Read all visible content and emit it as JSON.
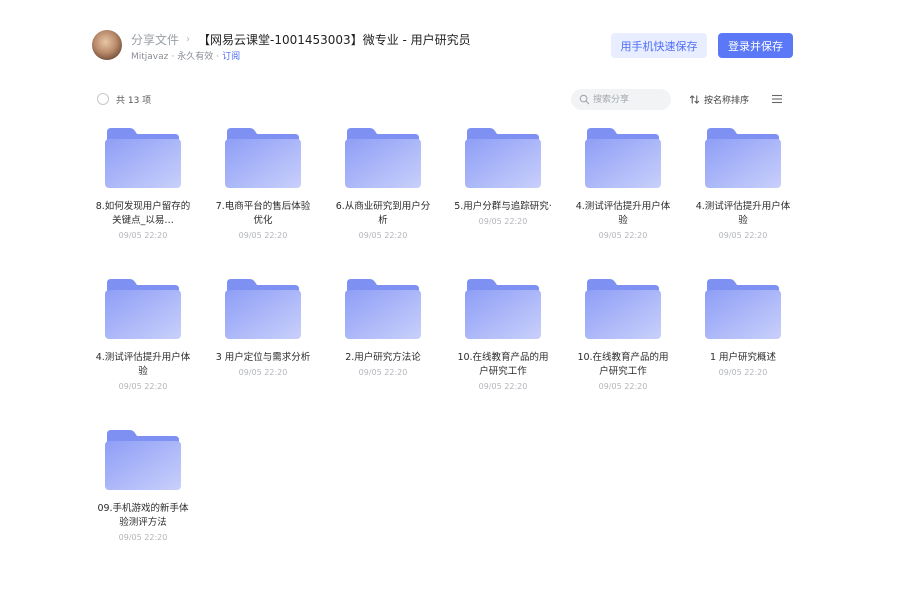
{
  "header": {
    "breadcrumb_root": "分享文件",
    "breadcrumb_separator": "›",
    "title": "【网易云课堂-1001453003】微专业 - 用户研究员",
    "owner": "Mitjavaz",
    "separator": "·",
    "validity": "永久有效",
    "subscribe_label": "订阅",
    "phone_save_label": "用手机快速保存",
    "login_save_label": "登录并保存"
  },
  "toolbar": {
    "count_label": "共 13 项",
    "search_placeholder": "搜索分享",
    "sort_label": "按名称排序"
  },
  "colors": {
    "accent": "#5b78f7",
    "accent_light": "#e8edff",
    "folder_front_top": "#8e9ef6",
    "folder_front_bottom": "#c9d0fb",
    "folder_back": "#7f90f3"
  },
  "files": [
    {
      "name": "8.如何发现用户留存的关键点_以易…",
      "date": "09/05 22:20",
      "icon": "folder-icon"
    },
    {
      "name": "7.电商平台的售后体验优化",
      "date": "09/05 22:20",
      "icon": "folder-icon"
    },
    {
      "name": "6.从商业研究到用户分析",
      "date": "09/05 22:20",
      "icon": "folder-icon"
    },
    {
      "name": "5.用户分群与追踪研究·",
      "date": "09/05 22:20",
      "icon": "folder-icon"
    },
    {
      "name": "4.测试评估提升用户体验",
      "date": "09/05 22:20",
      "icon": "folder-icon"
    },
    {
      "name": "4.测试评估提升用户体验",
      "date": "09/05 22:20",
      "icon": "folder-icon"
    },
    {
      "name": "4.测试评估提升用户体验",
      "date": "09/05 22:20",
      "icon": "folder-icon"
    },
    {
      "name": "3 用户定位与需求分析",
      "date": "09/05 22:20",
      "icon": "folder-icon"
    },
    {
      "name": "2.用户研究方法论",
      "date": "09/05 22:20",
      "icon": "folder-icon"
    },
    {
      "name": "10.在线教育产品的用户研究工作",
      "date": "09/05 22:20",
      "icon": "folder-icon"
    },
    {
      "name": "10.在线教育产品的用户研究工作",
      "date": "09/05 22:20",
      "icon": "folder-icon"
    },
    {
      "name": "1 用户研究概述",
      "date": "09/05 22:20",
      "icon": "folder-icon"
    },
    {
      "name": "09.手机游戏的新手体验测评方法",
      "date": "09/05 22:20",
      "icon": "folder-icon"
    }
  ]
}
